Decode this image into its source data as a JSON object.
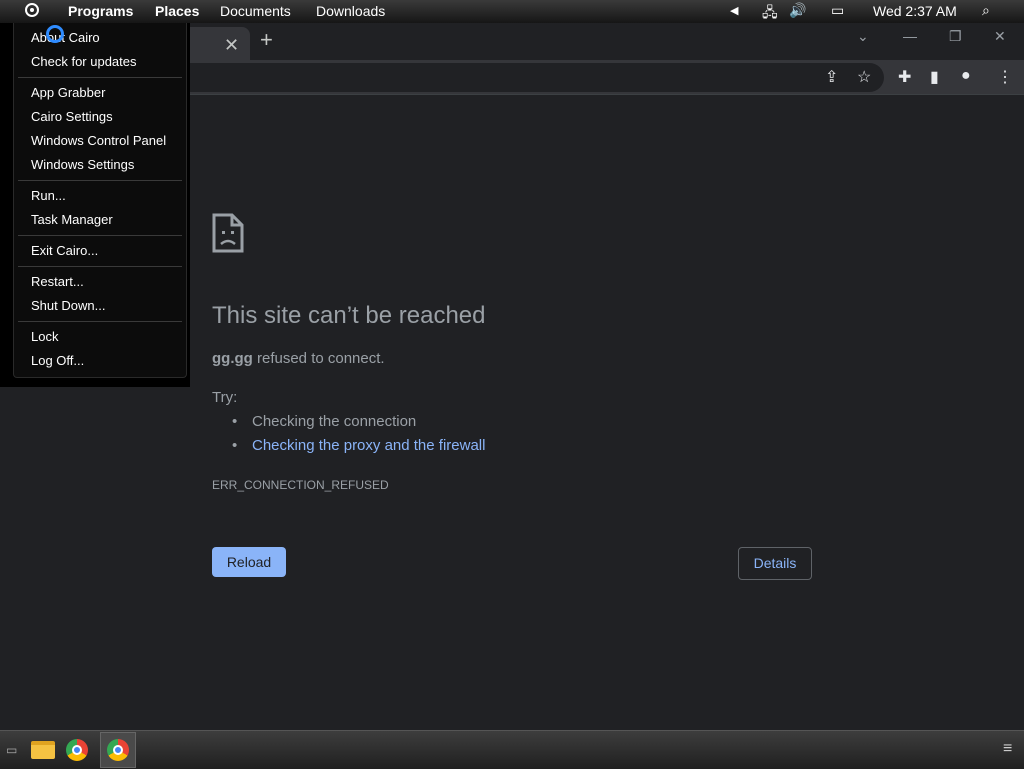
{
  "menubar": {
    "items": [
      "Programs",
      "Places",
      "Documents",
      "Downloads"
    ],
    "clock": "Wed 2:37 AM"
  },
  "cairo_menu": {
    "groups": [
      [
        "About Cairo",
        "Check for updates"
      ],
      [
        "App Grabber",
        "Cairo Settings",
        "Windows Control Panel",
        "Windows Settings"
      ],
      [
        "Run...",
        "Task Manager"
      ],
      [
        "Exit Cairo..."
      ],
      [
        "Restart...",
        "Shut Down..."
      ],
      [
        "Lock",
        "Log Off..."
      ]
    ]
  },
  "browser": {
    "error": {
      "title": "This site can’t be reached",
      "host": "gg.gg",
      "message": " refused to connect.",
      "try_label": "Try:",
      "suggestions": [
        "Checking the connection",
        "Checking the proxy and the firewall"
      ],
      "code": "ERR_CONNECTION_REFUSED",
      "reload_label": "Reload",
      "details_label": "Details"
    }
  },
  "colors": {
    "page_bg": "#202124",
    "link_blue": "#8ab4f8",
    "muted_text": "#9aa0a6",
    "accent_cursor": "#2f8cff"
  }
}
